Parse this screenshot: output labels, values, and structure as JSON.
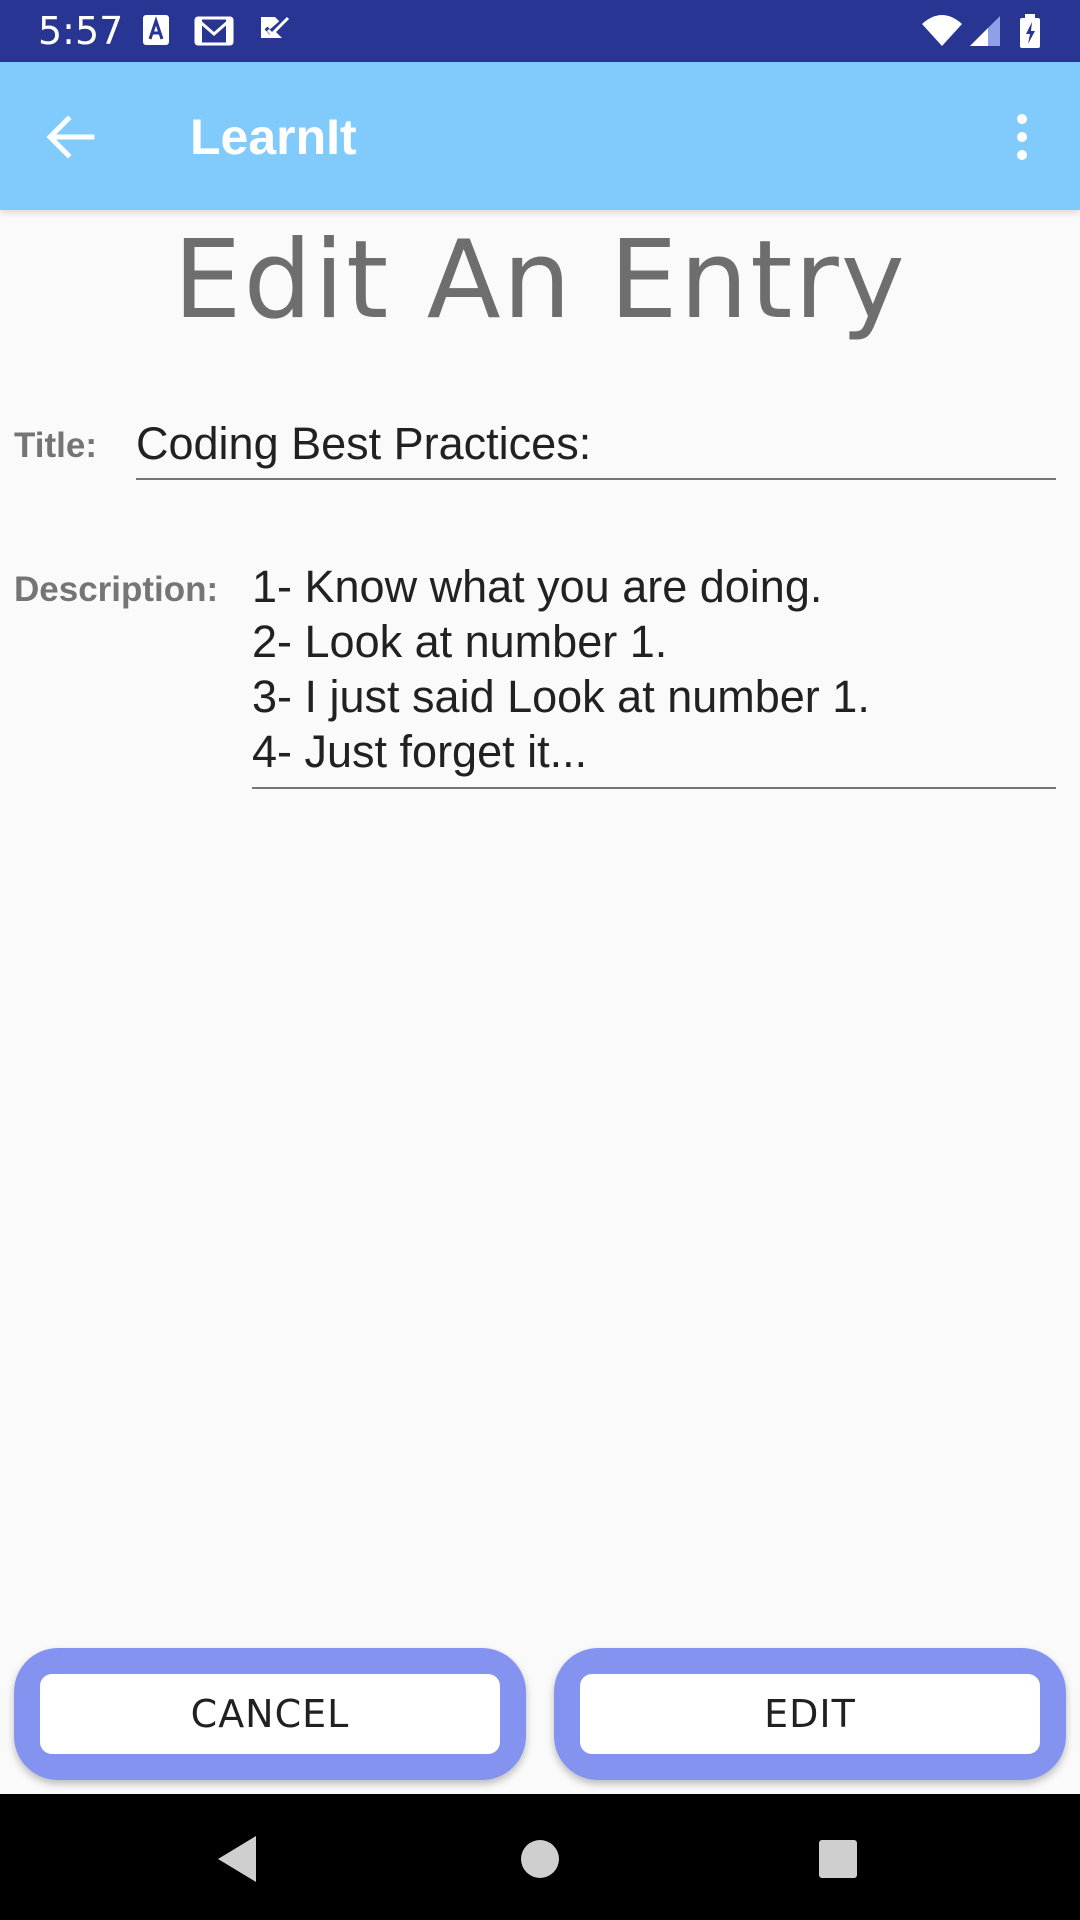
{
  "status_bar": {
    "time": "5:57",
    "left_icons": [
      "font-a-icon",
      "gmail-icon",
      "check-task-icon"
    ],
    "right_icons": [
      "wifi-icon",
      "cell-signal-icon",
      "battery-icon"
    ],
    "color": "#283593"
  },
  "app_bar": {
    "title": "LearnIt",
    "back_icon": "arrow-back-icon",
    "overflow_icon": "more-vert-icon",
    "color": "#80cbfc"
  },
  "page": {
    "heading": "Edit An Entry"
  },
  "form": {
    "title_label": "Title:",
    "title_value": "Coding Best Practices:",
    "description_label": "Description:",
    "description_lines": [
      "1- Know what you are doing.",
      "2- Look at number 1.",
      "3- I just said Look at number 1.",
      "4- Just forget it..."
    ]
  },
  "actions": {
    "cancel_label": "CANCEL",
    "edit_label": "EDIT",
    "button_accent": "#8593f0"
  },
  "nav_bar": {
    "icons": [
      "nav-back-icon",
      "nav-home-icon",
      "nav-recents-icon"
    ]
  }
}
